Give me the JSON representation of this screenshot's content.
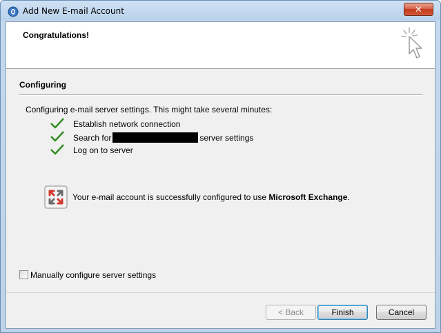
{
  "window": {
    "title": "Add New E-mail Account",
    "close_glyph": "✕"
  },
  "header": {
    "title": "Congratulations!",
    "icon": "cursor-sparkle-icon"
  },
  "section": {
    "title": "Configuring",
    "intro": "Configuring e-mail server settings. This might take several minutes:"
  },
  "steps": [
    {
      "label": "Establish network connection",
      "status": "done"
    },
    {
      "label_prefix": "Search for",
      "label_suffix": "server settings",
      "status": "done"
    },
    {
      "label": "Log on to server",
      "status": "done"
    }
  ],
  "result": {
    "text_prefix": "Your e-mail account is successfully configured to use ",
    "server_type": "Microsoft Exchange",
    "text_suffix": ".",
    "icon": "exchange-icon"
  },
  "manual_config": {
    "label": "Manually configure server settings",
    "checked": false
  },
  "buttons": {
    "back": "< Back",
    "finish": "Finish",
    "cancel": "Cancel"
  },
  "colors": {
    "check": "#2e8b1e",
    "close": "#c23a1c"
  }
}
